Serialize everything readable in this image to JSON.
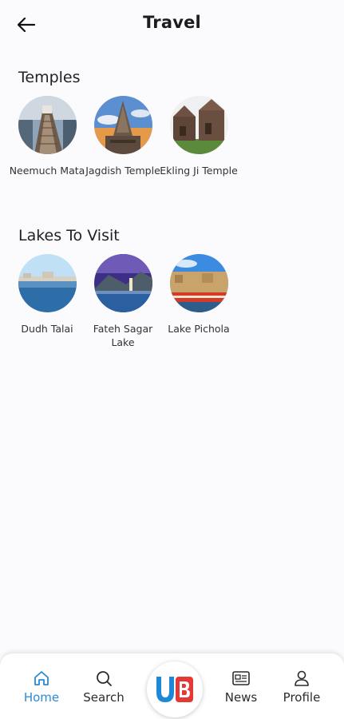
{
  "header": {
    "title": "Travel"
  },
  "sections": [
    {
      "title": "Temples",
      "items": [
        {
          "label": "Neemuch Mata"
        },
        {
          "label": "Jagdish Temple"
        },
        {
          "label": "Ekling Ji Temple"
        }
      ]
    },
    {
      "title": "Lakes To Visit",
      "items": [
        {
          "label": "Dudh Talai"
        },
        {
          "label": "Fateh Sagar Lake"
        },
        {
          "label": "Lake Pichola"
        }
      ]
    }
  ],
  "nav": {
    "home": "Home",
    "search": "Search",
    "news": "News",
    "profile": "Profile"
  },
  "colors": {
    "accent": "#2a8bd6",
    "logo_blue": "#1e88d8",
    "logo_red": "#e53935"
  }
}
